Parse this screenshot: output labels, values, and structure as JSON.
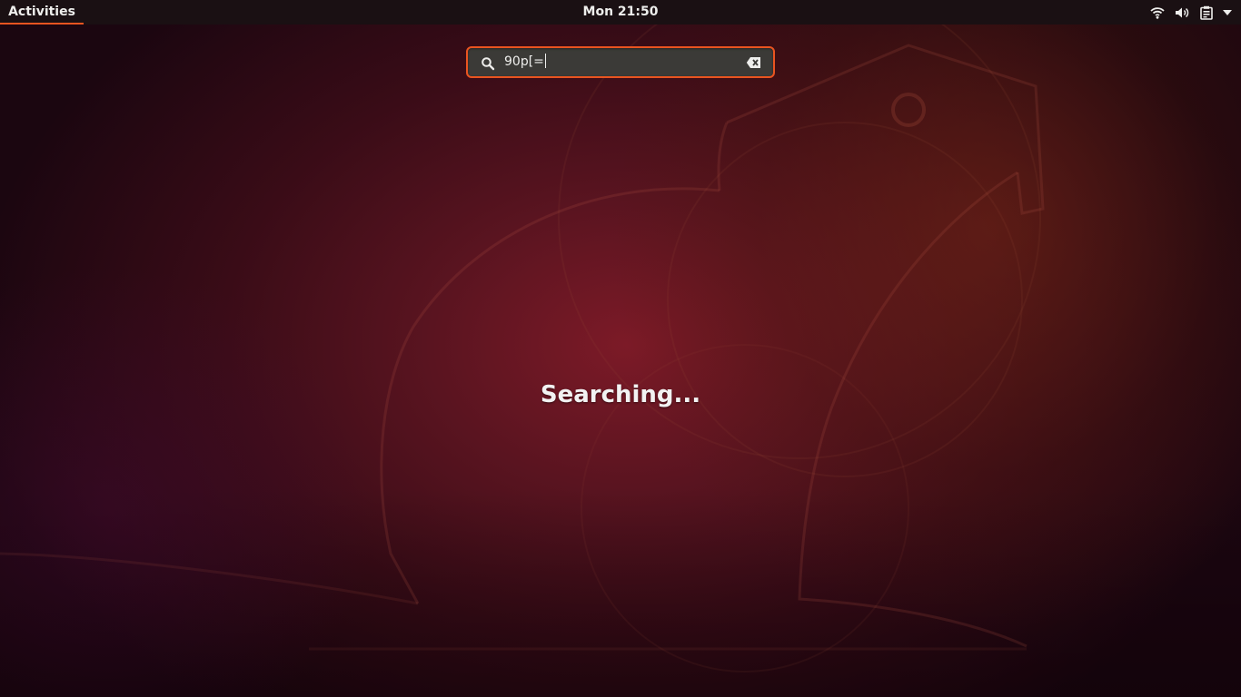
{
  "top_bar": {
    "activities_label": "Activities",
    "clock": "Mon 21:50",
    "status_icons": [
      "wifi-icon",
      "volume-icon",
      "clipboard-icon",
      "dropdown-arrow-icon"
    ]
  },
  "search": {
    "value": "90p[=",
    "has_focus": true
  },
  "overview": {
    "status_message": "Searching..."
  },
  "colors": {
    "accent": "#e95420",
    "top_bar_bg": "#1a1013",
    "entry_bg": "#3b3a37"
  }
}
